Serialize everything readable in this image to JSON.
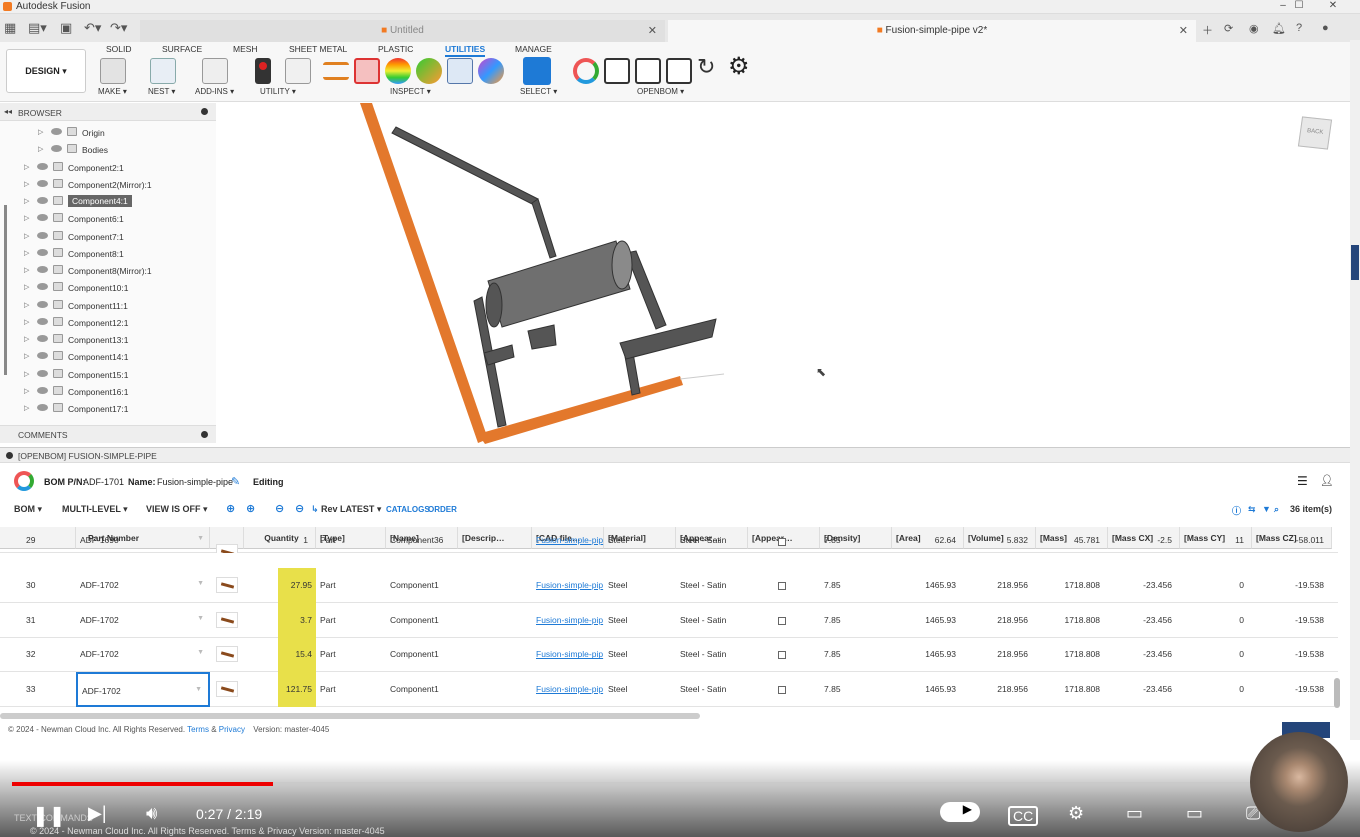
{
  "app": {
    "title": "Autodesk Fusion"
  },
  "tabs": {
    "untitled": "Untitled",
    "active": "Fusion-simple-pipe v2*"
  },
  "ribbon": {
    "workspace": "DESIGN ▾",
    "tabs": [
      "SOLID",
      "SURFACE",
      "MESH",
      "SHEET METAL",
      "PLASTIC",
      "UTILITIES",
      "MANAGE"
    ],
    "active_tab": "UTILITIES",
    "groups": [
      "MAKE ▾",
      "NEST ▾",
      "ADD-INS ▾",
      "UTILITY ▾",
      "INSPECT ▾",
      "SELECT ▾",
      "OPENBOM ▾"
    ]
  },
  "browser": {
    "title": "BROWSER",
    "comments": "COMMENTS",
    "items": [
      {
        "label": "Origin"
      },
      {
        "label": "Bodies"
      },
      {
        "label": "Component2:1"
      },
      {
        "label": "Component2(Mirror):1"
      },
      {
        "label": "Component4:1"
      },
      {
        "label": "Component6:1"
      },
      {
        "label": "Component7:1"
      },
      {
        "label": "Component8:1"
      },
      {
        "label": "Component8(Mirror):1"
      },
      {
        "label": "Component10:1"
      },
      {
        "label": "Component11:1"
      },
      {
        "label": "Component12:1"
      },
      {
        "label": "Component13:1"
      },
      {
        "label": "Component14:1"
      },
      {
        "label": "Component15:1"
      },
      {
        "label": "Component16:1"
      },
      {
        "label": "Component17:1"
      }
    ]
  },
  "viewcube": {
    "face": "BACK"
  },
  "openbom": {
    "panel_title": "[OPENBOM] FUSION-SIMPLE-PIPE",
    "bom_pn_label": "BOM P/N:",
    "bom_pn": "ADF-1701",
    "name_label": "Name:",
    "name": "Fusion-simple-pipe",
    "status": "Editing",
    "toolbar": {
      "bom": "BOM ▾",
      "level": "MULTI-LEVEL ▾",
      "view": "VIEW IS OFF ▾",
      "rev": "Rev LATEST ▾",
      "catalogs": "CATALOGS",
      "order": "ORDER",
      "count": "36 item(s)"
    },
    "columns": [
      "Part Number",
      "Quantity",
      "[Type]",
      "[Name]",
      "[Descrip…",
      "[CAD file…",
      "[Material]",
      "[Appear…",
      "[Appear…",
      "[Density]",
      "[Area]",
      "[Volume]",
      "[Mass]",
      "[Mass CX]",
      "[Mass CY]",
      "[Mass CZ]"
    ],
    "rows": [
      {
        "idx": "29",
        "pn": "ADF-1690",
        "qty": "1",
        "type": "Part",
        "name": "Component36",
        "cad": "Fusion-simple-pip",
        "mat": "Steel",
        "app": "Steel - Satin",
        "den": "7.85",
        "area": "62.64",
        "vol": "5.832",
        "mass": "45.781",
        "cx": "-2.5",
        "cy": "11",
        "cz": "-58.011"
      },
      {
        "idx": "30",
        "pn": "ADF-1702",
        "qty": "27.95",
        "type": "Part",
        "name": "Component1",
        "cad": "Fusion-simple-pip",
        "mat": "Steel",
        "app": "Steel - Satin",
        "den": "7.85",
        "area": "1465.93",
        "vol": "218.956",
        "mass": "1718.808",
        "cx": "-23.456",
        "cy": "0",
        "cz": "-19.538"
      },
      {
        "idx": "31",
        "pn": "ADF-1702",
        "qty": "3.7",
        "type": "Part",
        "name": "Component1",
        "cad": "Fusion-simple-pip",
        "mat": "Steel",
        "app": "Steel - Satin",
        "den": "7.85",
        "area": "1465.93",
        "vol": "218.956",
        "mass": "1718.808",
        "cx": "-23.456",
        "cy": "0",
        "cz": "-19.538"
      },
      {
        "idx": "32",
        "pn": "ADF-1702",
        "qty": "15.4",
        "type": "Part",
        "name": "Component1",
        "cad": "Fusion-simple-pip",
        "mat": "Steel",
        "app": "Steel - Satin",
        "den": "7.85",
        "area": "1465.93",
        "vol": "218.956",
        "mass": "1718.808",
        "cx": "-23.456",
        "cy": "0",
        "cz": "-19.538"
      },
      {
        "idx": "33",
        "pn": "ADF-1702",
        "qty": "121.75",
        "type": "Part",
        "name": "Component1",
        "cad": "Fusion-simple-pip",
        "mat": "Steel",
        "app": "Steel - Satin",
        "den": "7.85",
        "area": "1465.93",
        "vol": "218.956",
        "mass": "1718.808",
        "cx": "-23.456",
        "cy": "0",
        "cz": "-19.538"
      }
    ],
    "footer": {
      "copyright": "© 2024 - Newman Cloud Inc. All Rights Reserved.",
      "terms": "Terms",
      "amp": "&",
      "privacy": "Privacy",
      "version": "Version: master-4045"
    }
  },
  "video": {
    "time": "0:27 / 2:19",
    "progress": 0.195,
    "overlay_text": "TEXT COMMANDS",
    "ghost_footer": "© 2024 - Newman Cloud Inc. All Rights Reserved.   Terms & Privacy   Version: master-4045"
  },
  "colors": {
    "accent": "#1e7ad6",
    "highlight": "#e8e04a",
    "pipe_orange": "#e3782c",
    "progress_red": "#e00000"
  }
}
